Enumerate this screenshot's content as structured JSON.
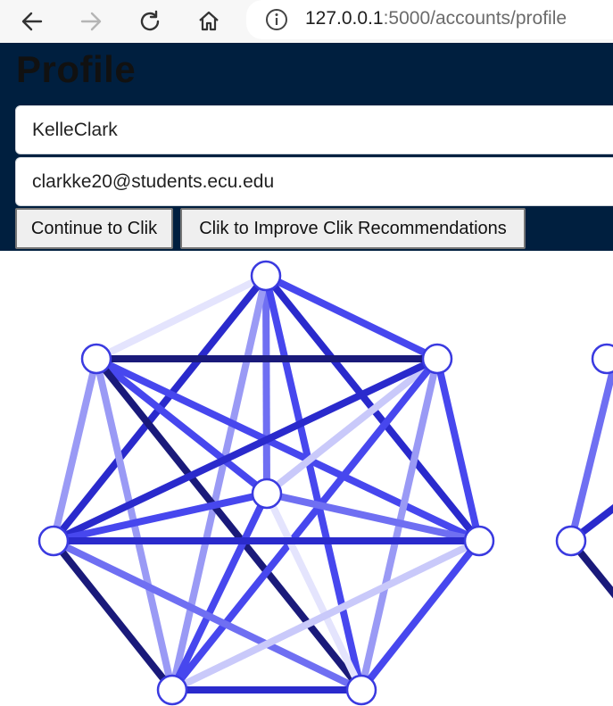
{
  "browser": {
    "url_host": "127.0.0.1",
    "url_path": ":5000/accounts/profile",
    "icons": [
      "back-arrow-icon",
      "forward-arrow-icon",
      "reload-icon",
      "home-icon",
      "info-icon"
    ]
  },
  "page": {
    "title": "Profile"
  },
  "form": {
    "username_value": "KelleClark",
    "email_value": "clarkke20@students.ecu.edu",
    "continue_label": "Continue to Clik",
    "improve_label": "Clik to Improve Clik Recommendations"
  },
  "graph": {
    "edge_colors": [
      "#1a1a7a",
      "#2a2acc",
      "#4747ee",
      "#6f6ff2",
      "#9a9af5",
      "#c9c9fa",
      "#e4e4fd"
    ],
    "node_color": "#ffffff",
    "node_stroke": "#3a3ae0"
  }
}
